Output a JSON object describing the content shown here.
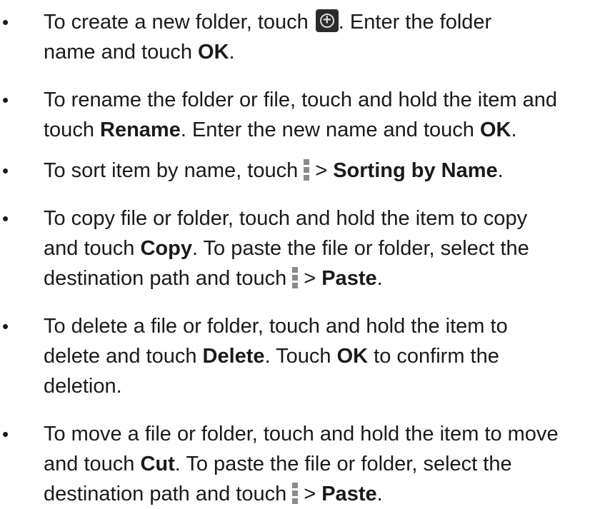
{
  "bullet_char": "•",
  "icons": {
    "add": "add-folder-icon",
    "menu": "menu-icon"
  },
  "items": [
    {
      "line1_a": "To create a new folder, touch",
      "line1_b": ". Enter the folder",
      "line2_a": "name and touch ",
      "line2_bold": "OK",
      "line2_end": "."
    },
    {
      "line1": "To rename the folder or file, touch and hold the item and",
      "line2_a": "touch ",
      "line2_bold1": "Rename",
      "line2_b": ". Enter the new name and touch ",
      "line2_bold2": "OK",
      "line2_end": "."
    },
    {
      "line1_a": "To sort item by name, touch",
      "line1_b": "> ",
      "line1_bold": "Sorting by Name",
      "line1_end": "."
    },
    {
      "line1": "To copy file or folder, touch and hold the item to copy",
      "line2_a": "and touch ",
      "line2_bold": "Copy",
      "line2_b": ". To paste the file or folder, select the",
      "line3_a": "destination path and touch",
      "line3_b": "> ",
      "line3_bold": "Paste",
      "line3_end": "."
    },
    {
      "line1": "To delete a file or folder, touch and hold the item to",
      "line2_a": "delete and touch ",
      "line2_bold1": "Delete",
      "line2_b": ". Touch ",
      "line2_bold2": "OK",
      "line2_c": " to confirm the",
      "line3": "deletion."
    },
    {
      "line1": "To move a file or folder, touch and hold the item to move",
      "line2_a": "and touch ",
      "line2_bold": "Cut",
      "line2_b": ". To paste the file or folder, select the",
      "line3_a": "destination path and touch",
      "line3_b": "> ",
      "line3_bold": "Paste",
      "line3_end": "."
    }
  ]
}
